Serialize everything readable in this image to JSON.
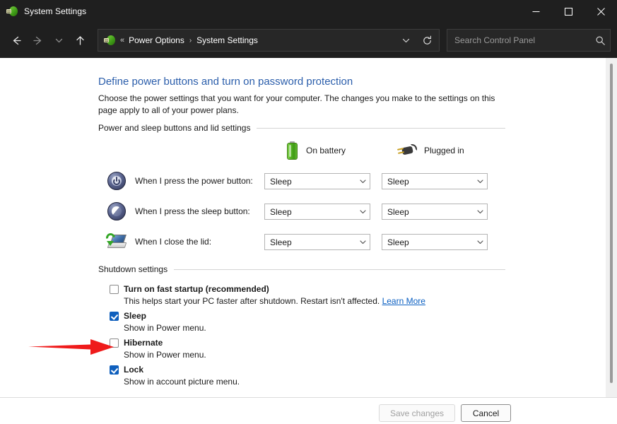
{
  "window": {
    "title": "System Settings",
    "icon": "power-plug-icon",
    "controls": {
      "minimize": "minimize-icon",
      "maximize": "maximize-icon",
      "close": "close-icon"
    }
  },
  "nav": {
    "back": "back-arrow-icon",
    "forward": "forward-arrow-icon",
    "recent": "chevron-down-icon",
    "up": "up-arrow-icon",
    "address": {
      "icon": "power-plug-icon",
      "overflow": "«",
      "crumbs": [
        "Power Options",
        "System Settings"
      ],
      "separator": "›",
      "dropdown": "chevron-down-icon",
      "refresh": "refresh-icon"
    },
    "search": {
      "placeholder": "Search Control Panel",
      "value": "",
      "icon": "search-icon"
    }
  },
  "page": {
    "heading": "Define power buttons and turn on password protection",
    "subtext": "Choose the power settings that you want for your computer. The changes you make to the settings on this page apply to all of your power plans."
  },
  "power_section": {
    "label": "Power and sleep buttons and lid settings",
    "columns": [
      {
        "label": "On battery",
        "icon": "battery-icon"
      },
      {
        "label": "Plugged in",
        "icon": "plug-icon"
      }
    ],
    "rows": [
      {
        "icon": "power-button-icon",
        "label": "When I press the power button:",
        "on_battery": "Sleep",
        "plugged_in": "Sleep"
      },
      {
        "icon": "sleep-button-icon",
        "label": "When I press the sleep button:",
        "on_battery": "Sleep",
        "plugged_in": "Sleep"
      },
      {
        "icon": "laptop-lid-icon",
        "label": "When I close the lid:",
        "on_battery": "Sleep",
        "plugged_in": "Sleep"
      }
    ]
  },
  "shutdown_section": {
    "label": "Shutdown settings",
    "fast_startup": {
      "label": "Turn on fast startup (recommended)",
      "checked": false,
      "description": "This helps start your PC faster after shutdown. Restart isn't affected.",
      "link": "Learn More"
    },
    "options": [
      {
        "label": "Sleep",
        "checked": true,
        "description": "Show in Power menu."
      },
      {
        "label": "Hibernate",
        "checked": false,
        "description": "Show in Power menu."
      },
      {
        "label": "Lock",
        "checked": true,
        "description": "Show in account picture menu."
      }
    ]
  },
  "footer": {
    "save_label": "Save changes",
    "save_disabled": true,
    "cancel_label": "Cancel"
  },
  "annotation": {
    "type": "red-arrow",
    "color": "#ef1b1b",
    "points_to": "fast-startup-checkbox"
  },
  "colors": {
    "titlebar_bg": "#1f1f1f",
    "heading_blue": "#2b5eab",
    "link_blue": "#0a5fc2",
    "checkbox_checked": "#0f5fbd",
    "annotation_red": "#ef1b1b"
  }
}
